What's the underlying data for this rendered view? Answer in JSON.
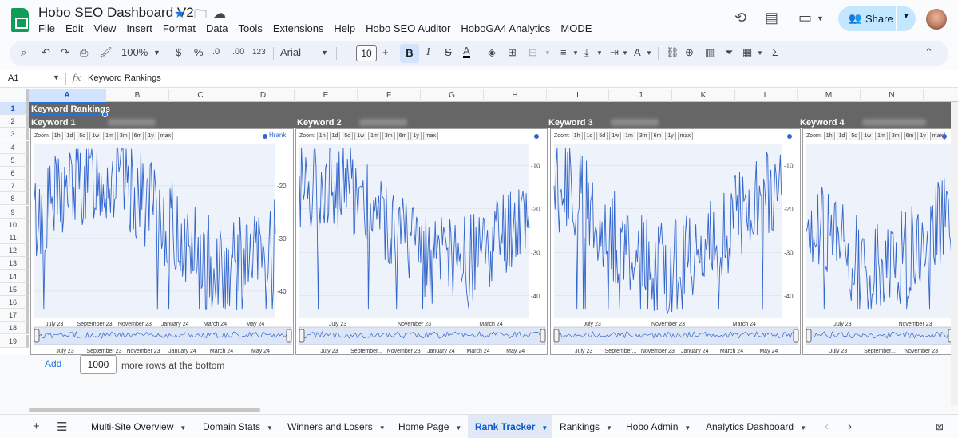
{
  "doc": {
    "title": "Hobo SEO Dashboard V2"
  },
  "menu": [
    "File",
    "Edit",
    "View",
    "Insert",
    "Format",
    "Data",
    "Tools",
    "Extensions",
    "Help",
    "Hobo SEO Auditor",
    "HoboGA4 Analytics",
    "MODE"
  ],
  "share": {
    "label": "Share"
  },
  "toolbar": {
    "zoom": "100%",
    "currency": "$",
    "percent": "%",
    "dec_decrease": ".0",
    "dec_increase": ".00",
    "number_format": "123",
    "font": "Arial",
    "font_size": "10",
    "bold": "B",
    "italic": "I",
    "strike": "S",
    "text_color": "A",
    "function": "Σ"
  },
  "formula_bar": {
    "cell_ref": "A1",
    "fx": "fx",
    "value": "Keyword Rankings"
  },
  "columns": [
    "A",
    "B",
    "C",
    "D",
    "E",
    "F",
    "G",
    "H",
    "I",
    "J",
    "K",
    "L",
    "M",
    "N"
  ],
  "rows": [
    "1",
    "2",
    "3",
    "4",
    "5",
    "6",
    "7",
    "8",
    "9",
    "10",
    "11",
    "12",
    "13",
    "14",
    "15",
    "16",
    "17",
    "18",
    "19"
  ],
  "sheet": {
    "title_cell": "Keyword Rankings",
    "keywords": [
      "Keyword 1",
      "Keyword 2",
      "Keyword 3",
      "Keyword 4"
    ]
  },
  "zoom_buttons": [
    "1h",
    "1d",
    "5d",
    "1w",
    "1m",
    "3m",
    "6m",
    "1y",
    "max"
  ],
  "legend": {
    "label": "Hrank"
  },
  "chart_data": [
    {
      "type": "line",
      "title": "Keyword 1",
      "series": [
        {
          "name": "Hrank"
        }
      ],
      "y_ticks": [
        "-20",
        "-30",
        "-40"
      ],
      "x_ticks": [
        "July 23",
        "September 23",
        "November 23",
        "January 24",
        "March 24",
        "May 24"
      ],
      "navigator_ticks": [
        "July 23",
        "September 23",
        "November 23",
        "January 24",
        "March 24",
        "May 24"
      ],
      "ylim": [
        -45,
        -12
      ],
      "y_inverted": true
    },
    {
      "type": "line",
      "title": "Keyword 2",
      "series": [
        {}
      ],
      "y_ticks": [
        "-10",
        "-20",
        "-30",
        "-40"
      ],
      "x_ticks": [
        "July 23",
        "November 23",
        "March 24"
      ],
      "navigator_ticks": [
        "July 23",
        "September...",
        "November 23",
        "January 24",
        "March 24",
        "May 24"
      ],
      "ylim": [
        -45,
        -5
      ],
      "y_inverted": true
    },
    {
      "type": "line",
      "title": "Keyword 3",
      "series": [
        {}
      ],
      "y_ticks": [
        "-10",
        "-20",
        "-30",
        "-40"
      ],
      "x_ticks": [
        "July 23",
        "November 23",
        "March 24"
      ],
      "navigator_ticks": [
        "July 23",
        "September...",
        "November 23",
        "January 24",
        "March 24",
        "May 24"
      ],
      "ylim": [
        -45,
        -5
      ],
      "y_inverted": true
    },
    {
      "type": "line",
      "title": "Keyword 4",
      "series": [
        {}
      ],
      "y_ticks": [],
      "x_ticks": [
        "July 23",
        "November 23"
      ],
      "navigator_ticks": [
        "July 23",
        "September...",
        "November 23"
      ],
      "ylim": [
        -45,
        -5
      ],
      "y_inverted": true
    }
  ],
  "add_rows": {
    "add_label": "Add",
    "count": "1000",
    "suffix": "more rows at the bottom"
  },
  "tabs": [
    {
      "label": "Multi-Site Overview",
      "active": false
    },
    {
      "label": "Domain Stats",
      "active": false
    },
    {
      "label": "Winners and Losers",
      "active": false
    },
    {
      "label": "Home Page",
      "active": false
    },
    {
      "label": "Rank Tracker",
      "active": true
    },
    {
      "label": "Rankings",
      "active": false
    },
    {
      "label": "Hobo Admin",
      "active": false
    },
    {
      "label": "Analytics Dashboard",
      "active": false
    }
  ],
  "colors": {
    "series": "#3366cc",
    "accent": "#1a73e8",
    "header_band": "#666666"
  }
}
